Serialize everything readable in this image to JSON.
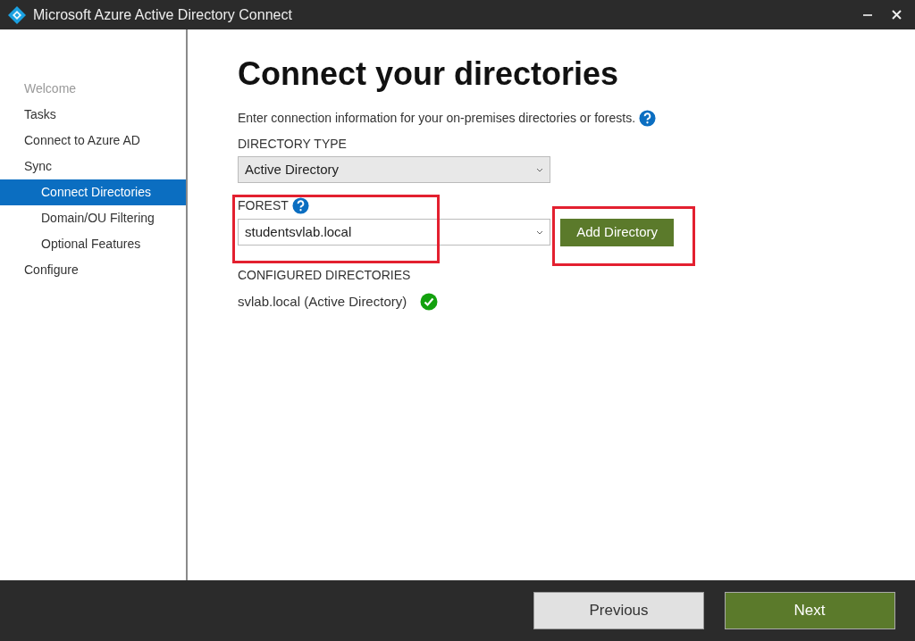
{
  "window": {
    "title": "Microsoft Azure Active Directory Connect"
  },
  "sidebar": {
    "items": [
      {
        "label": "Welcome",
        "disabled": true,
        "selected": false
      },
      {
        "label": "Tasks",
        "disabled": false,
        "selected": false
      },
      {
        "label": "Connect to Azure AD",
        "disabled": false,
        "selected": false
      },
      {
        "label": "Sync",
        "disabled": false,
        "selected": false,
        "children": [
          {
            "label": "Connect Directories",
            "disabled": false,
            "selected": true
          },
          {
            "label": "Domain/OU Filtering",
            "disabled": false,
            "selected": false
          },
          {
            "label": "Optional Features",
            "disabled": false,
            "selected": false
          }
        ]
      },
      {
        "label": "Configure",
        "disabled": false,
        "selected": false
      }
    ]
  },
  "page": {
    "heading": "Connect your directories",
    "intro": "Enter connection information for your on-premises directories or forests.",
    "directory_type": {
      "label": "DIRECTORY TYPE",
      "value": "Active Directory"
    },
    "forest": {
      "label": "FOREST",
      "value": "studentsvlab.local",
      "highlighted": true
    },
    "add_button": {
      "label": "Add Directory",
      "highlighted": true
    },
    "configured": {
      "label": "CONFIGURED DIRECTORIES",
      "items": [
        {
          "name": "svlab.local (Active Directory)",
          "ok": true
        }
      ]
    }
  },
  "footer": {
    "buttons": [
      {
        "label": "Previous",
        "kind": "secondary"
      },
      {
        "label": "Next",
        "kind": "primary"
      }
    ]
  }
}
